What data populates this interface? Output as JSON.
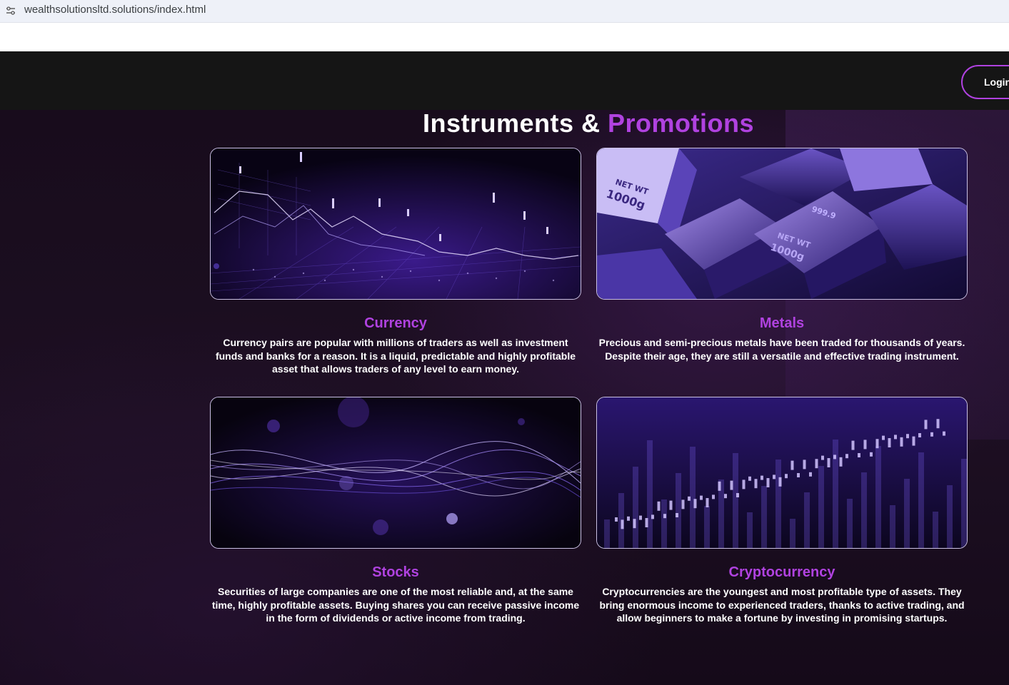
{
  "browser": {
    "url": "wealthsolutionsltd.solutions/index.html",
    "site_info_icon": "tune-icon"
  },
  "header": {
    "login_label": "Login"
  },
  "section": {
    "title_main": "Instruments &",
    "title_accent": "Promotions"
  },
  "colors": {
    "accent": "#b042e0",
    "navbar": "#151515",
    "background": "#1a0d1f"
  },
  "cards": [
    {
      "title": "Currency",
      "description": "Currency pairs are popular with millions of traders as well as investment funds and banks for a reason. It is a liquid, predictable and highly profitable asset that allows traders of any level to earn money.",
      "image": "currency-chart-image"
    },
    {
      "title": "Metals",
      "description": "Precious and semi-precious metals have been traded for thousands of years. Despite their age, they are still a versatile and effective trading instrument.",
      "image": "metal-bars-image",
      "image_text": [
        "NET WT",
        "1000g",
        "999.9",
        "NET WT",
        "1000g"
      ]
    },
    {
      "title": "Stocks",
      "description": "Securities of large companies are one of the most reliable and, at the same time, highly profitable assets. Buying shares you can receive passive income in the form of dividends or active income from trading.",
      "image": "light-waves-image"
    },
    {
      "title": "Cryptocurrency",
      "description": "Cryptocurrencies are the youngest and most profitable type of assets. They bring enormous income to experienced traders, thanks to active trading, and allow beginners to make a fortune by investing in promising startups.",
      "image": "crypto-candlestick-image"
    }
  ]
}
